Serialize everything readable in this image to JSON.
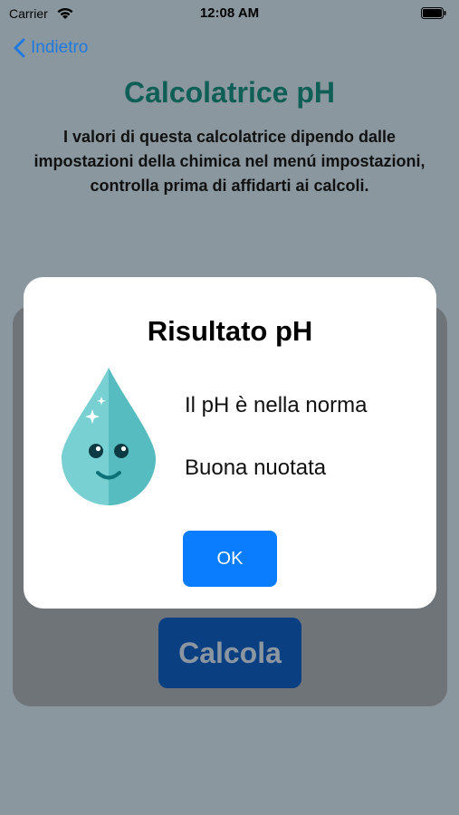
{
  "status_bar": {
    "carrier": "Carrier",
    "time": "12:08 AM"
  },
  "nav": {
    "back_label": "Indietro"
  },
  "page": {
    "title": "Calcolatrice pH",
    "notice_lines": [
      "I valori di questa calcolatrice dipendo dalle",
      "impostazioni della chimica nel menú impostazioni,",
      "controlla prima di affidarti ai calcoli."
    ],
    "calculate_label": "Calcola"
  },
  "dialog": {
    "title": "Risultato pH",
    "message_line_1": "Il pH è nella norma",
    "message_line_2": "Buona nuotata",
    "ok_label": "OK"
  },
  "colors": {
    "accent": "#0a7dfe",
    "title_green": "#0f5f57",
    "drop_teal": "#56c0c4"
  }
}
